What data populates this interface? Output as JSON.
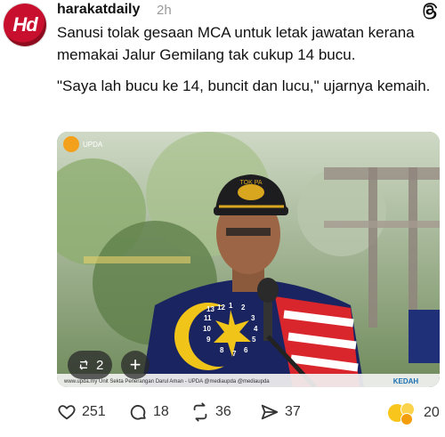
{
  "post": {
    "account": "harakatdaily",
    "avatar_text": "Hd",
    "time": "2h",
    "paragraphs": [
      "Sanusi tolak gesaan MCA untuk letak jawatan kerana memakai Jalur Gemilang tak cukup 14 bucu.",
      "\"Saya lah bucu ke 14, buncit dan lucu,\" ujarnya kemaih."
    ]
  },
  "media": {
    "logo_text": "UPDA",
    "cap_text": "TOK PA",
    "footer_text": "www.upda.my   Unit Sekta Penerangan Darul Aman - UPDA   @mediaupda   @mediaupda",
    "brand_right": "KEDAH",
    "star_numbers": [
      "13",
      "1",
      "2",
      "3",
      "4",
      "5",
      "6",
      "7",
      "8",
      "9",
      "10",
      "11",
      "12"
    ],
    "overlay": {
      "repost_count": "2"
    }
  },
  "actions": {
    "likes": "251",
    "comments": "18",
    "reposts": "36",
    "shares": "37",
    "reactions": "20"
  },
  "colors": {
    "avatar": "#c8102e",
    "text": "#111111",
    "muted": "#999999"
  },
  "icons": [
    "threads-icon",
    "repost-icon",
    "plus-icon",
    "heart-icon",
    "comment-icon",
    "repost-icon",
    "share-icon",
    "emoji-reactions-icon"
  ]
}
